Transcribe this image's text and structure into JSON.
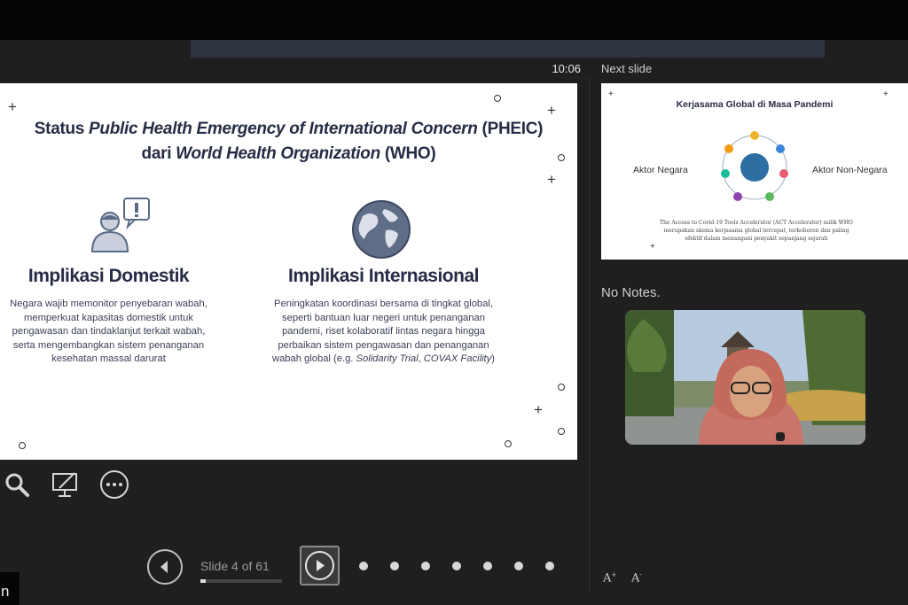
{
  "presenter": {
    "timer": "10:06",
    "next_slide_label": "Next slide",
    "notes_text": "No Notes.",
    "slide_counter": "Slide 4 of 61",
    "slide_progress": 0.066,
    "font_increase_label": "A",
    "font_decrease_label": "A",
    "corner_label": "n"
  },
  "current_slide": {
    "title_line1_pre": "Status ",
    "title_line1_italic": "Public Health Emergency of International Concern",
    "title_line1_post": " (PHEIC)",
    "title_line2_pre": "dari ",
    "title_line2_italic": "World Health Organization",
    "title_line2_post": " (WHO)",
    "domestic": {
      "heading": "Implikasi Domestik",
      "body": "Negara wajib memonitor penyebaran wabah, memperkuat kapasitas domestik untuk pengawasan dan tindaklanjut terkait wabah, serta mengembangkan sistem penanganan kesehatan massal darurat"
    },
    "international": {
      "heading": "Implikasi Internasional",
      "body_pre": "Peningkatan koordinasi bersama di tingkat global, seperti bantuan luar negeri untuk penanganan pandemi, riset kolaboratif lintas negara hingga perbaikan sistem pengawasan dan penanganan wabah global (e.g. ",
      "body_italic1": "Solidarity Trial",
      "body_mid": ", ",
      "body_italic2": "COVAX Facility",
      "body_post": ")"
    }
  },
  "next_slide": {
    "title": "Kerjasama Global di Masa Pandemi",
    "left_label": "Aktor Negara",
    "right_label": "Aktor Non-Negara",
    "caption": "The Access to Covid-19 Tools Accelerator (ACT Accelerator) milik WHO merupakan skema kerjasama global tercepat, terkoheren dan paling efektif dalam menangani penyakit sepanjang sejarah"
  },
  "colors": {
    "background": "#1f1f1f",
    "slide_text": "#262c45",
    "accent": "#4a6fa5"
  },
  "icons": [
    "search-icon",
    "pen-screen-icon",
    "more-options-icon",
    "previous-slide-icon",
    "next-slide-icon"
  ]
}
